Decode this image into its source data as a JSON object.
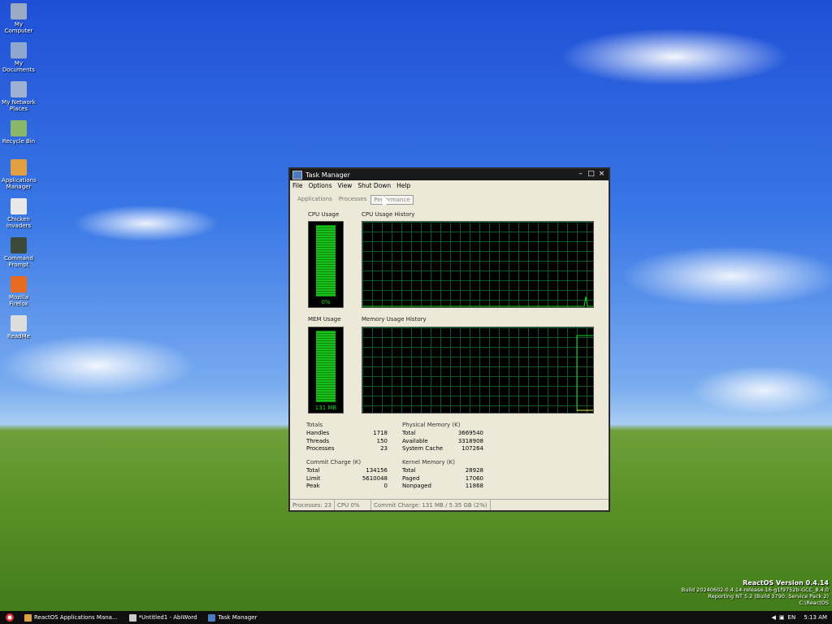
{
  "desktop": {
    "icons": [
      {
        "label": "My Computer",
        "color": "#9aa9c4"
      },
      {
        "label": "My Documents",
        "color": "#8fa7cf"
      },
      {
        "label": "My Network Places",
        "color": "#9db0d2"
      },
      {
        "label": "Recycle Bin",
        "color": "#8ab86a"
      },
      {
        "label": "Applications Manager",
        "color": "#e0a040"
      },
      {
        "label": "Chicken Invaders",
        "color": "#e8e8e8"
      },
      {
        "label": "Command Prompt",
        "color": "#3b4a3b"
      },
      {
        "label": "Mozilla Firefox",
        "color": "#e86a1e"
      },
      {
        "label": "ReadMe",
        "color": "#dddddd"
      }
    ]
  },
  "window": {
    "title": "Task Manager",
    "menu": [
      "File",
      "Options",
      "View",
      "Shut Down",
      "Help"
    ],
    "tabs": [
      "Applications",
      "Processes",
      "Performance"
    ],
    "active_tab": "Performance"
  },
  "performance": {
    "cpu_usage_label": "CPU Usage",
    "cpu_value": "0%",
    "cpu_history_label": "CPU Usage History",
    "mem_usage_label": "MEM Usage",
    "mem_value": "131 MB",
    "mem_history_label": "Memory Usage History",
    "totals": {
      "header": "Totals",
      "rows": [
        {
          "k": "Handles",
          "v": "1718"
        },
        {
          "k": "Threads",
          "v": "150"
        },
        {
          "k": "Processes",
          "v": "23"
        }
      ]
    },
    "physical": {
      "header": "Physical Memory (K)",
      "rows": [
        {
          "k": "Total",
          "v": "3669540"
        },
        {
          "k": "Available",
          "v": "3318908"
        },
        {
          "k": "System Cache",
          "v": "107264"
        }
      ]
    },
    "commit": {
      "header": "Commit Charge (K)",
      "rows": [
        {
          "k": "Total",
          "v": "134156"
        },
        {
          "k": "Limit",
          "v": "5610048"
        },
        {
          "k": "Peak",
          "v": "0"
        }
      ]
    },
    "kernel": {
      "header": "Kernel Memory (K)",
      "rows": [
        {
          "k": "Total",
          "v": "28928"
        },
        {
          "k": "Paged",
          "v": "17060"
        },
        {
          "k": "Nonpaged",
          "v": "11868"
        }
      ]
    }
  },
  "statusbar": {
    "processes": "Processes: 23",
    "cpu": "CPU    0%",
    "commit": "Commit Charge: 131 MB / 5.35 GB (2%)"
  },
  "watermark": {
    "line1": "ReactOS Version 0.4.14",
    "line2": "Build 20240602-0.4.14-release-16-g1f9752b-GCC_8.4.0",
    "line3": "Reporting NT 5.2 (Build 3790: Service Pack 2)",
    "line4": "C:\\ReactOS"
  },
  "taskbar": {
    "tasks": [
      {
        "label": "ReactOS Applications Mana...",
        "color": "#e0a040"
      },
      {
        "label": "*Untitled1 - AbiWord",
        "color": "#cccccc"
      },
      {
        "label": "Task Manager",
        "color": "#4a7bc0"
      }
    ],
    "lang": "EN",
    "clock": "5:13 AM"
  },
  "colors": {
    "graph_line": "#19d819",
    "mem_line": "#f0f060"
  }
}
